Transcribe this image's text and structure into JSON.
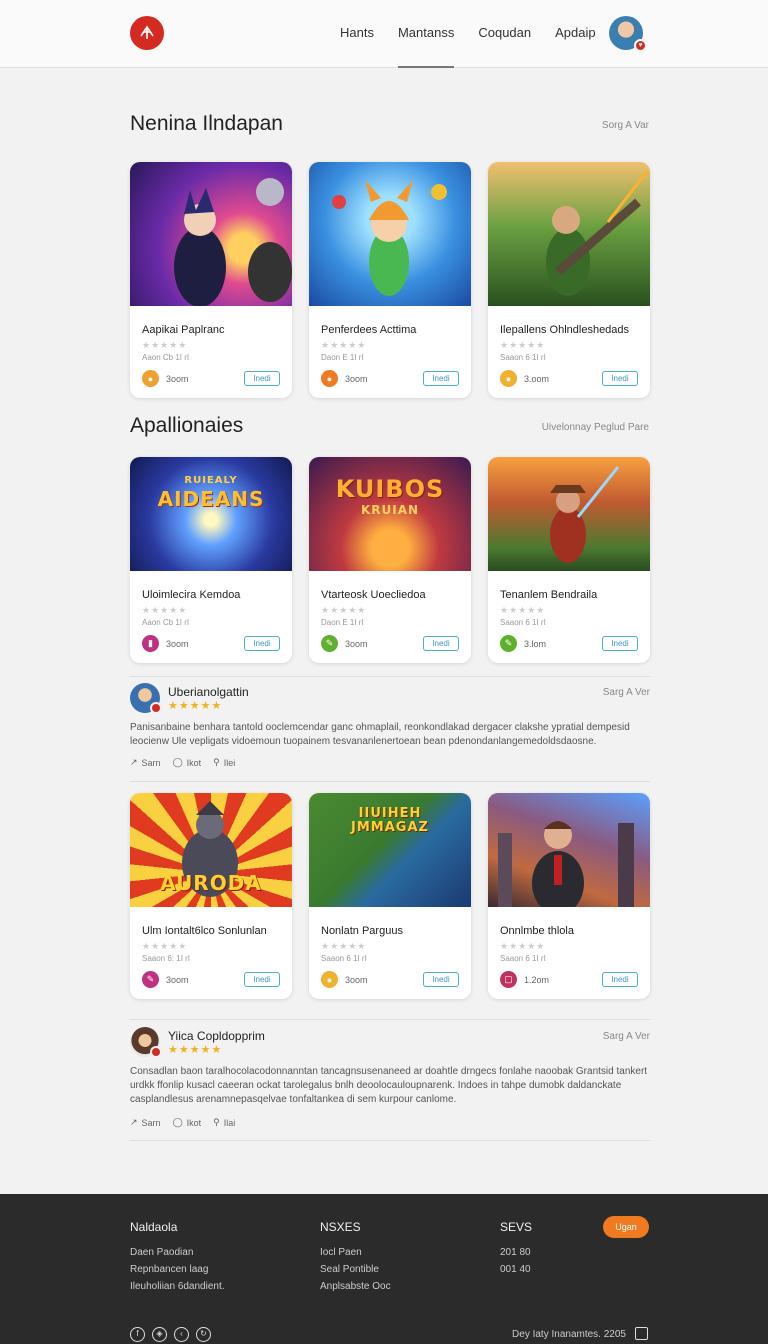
{
  "header": {
    "nav": [
      "Hants",
      "Mantanss",
      "Coqudan",
      "Apdaip"
    ],
    "active_index": 1
  },
  "sections": [
    {
      "title": "Nenina Ilndapan",
      "link": "Sorg A Var",
      "cards": [
        {
          "title": "Aapikai Paplranc",
          "meta": "Aaon Cb 1I rI",
          "size": "3oom",
          "button": "Inedi",
          "icon_color": "#f0a030",
          "icon": "app-badge-icon"
        },
        {
          "title": "Penferdees Acttima",
          "meta": "Daon E 1I rI",
          "size": "3oom",
          "button": "Inedi",
          "icon_color": "#f07a20",
          "icon": "app-badge-icon"
        },
        {
          "title": "Ilepallens Ohlndleshedads",
          "meta": "Saaon 6 1I rI",
          "size": "3.oom",
          "button": "Inedi",
          "icon_color": "#f0b030",
          "icon": "app-badge-icon"
        }
      ]
    },
    {
      "title": "Apallionaies",
      "link": "Uivelonnay Peglud Pare",
      "cards": [
        {
          "title": "Uloimlecira Kemdoa",
          "meta": "Aaon Cb 1I rI",
          "size": "3oom",
          "button": "Inedi",
          "icon_color": "#c03080",
          "icon": "app-badge-icon",
          "banner": "AIDEANS",
          "banner_top": "RUIEALY"
        },
        {
          "title": "Vtarteosk Uoecliedoa",
          "meta": "Daon E 1I rI",
          "size": "3oom",
          "button": "Inedi",
          "icon_color": "#60b030",
          "icon": "app-badge-icon",
          "banner": "KUIBOS",
          "banner_top": "KRUIAN"
        },
        {
          "title": "Tenanlem Bendraila",
          "meta": "Saaon 6 1I rI",
          "size": "3.lom",
          "button": "Inedi",
          "icon_color": "#60b030",
          "icon": "app-badge-icon"
        }
      ]
    },
    {
      "cards": [
        {
          "title": "Ulm Iontalt6lco Sonlunlan",
          "meta": "Saaon 6: 1I rI",
          "size": "3oom",
          "button": "Inedi",
          "icon_color": "#c03080",
          "icon": "app-badge-icon",
          "banner": "AURODA"
        },
        {
          "title": "Nonlatn Parguus",
          "meta": "Saaon 6 1I rI",
          "size": "3oom",
          "button": "Inedi",
          "icon_color": "#f0b030",
          "icon": "app-badge-icon",
          "banner": "IIUIHEH\nJMMAGAZ"
        },
        {
          "title": "Onnlmbe thlola",
          "meta": "Saaon 6 1I rI",
          "size": "1.2om",
          "button": "Inedi",
          "icon_color": "#c03060",
          "icon": "app-badge-icon"
        }
      ]
    }
  ],
  "reviews": [
    {
      "name": "Uberianolgattin",
      "stars": "★★★★★",
      "link": "Sarg A Ver",
      "text": "Panisanbaine benhara  tantold ooclemcendar ganc ohmaplail, reonkondlakad dergacer clakshe ypratial dempesid leocienw Ule vepligats vidoemoun tuopainem tesvananlenertoean bean pdenondanlangemedoldsdaosne.",
      "actions": [
        "Sarn",
        "Ikot",
        "Ilei"
      ]
    },
    {
      "name": "Yiica Copldopprim",
      "stars": "★★★★★",
      "link": "Sarg A Ver",
      "text": "Consadlan baon taralhocolacodonnanntan tancagnsusenaneed ar doahtle drngecs fonlahe naoobak Grantsid tankert urdkk ffonlip kusacl caeeran ockat tarolegalus bnlh deoolocauloupnarenk. Indoes in tahpe dumobk daldanckate casplandlesus arenamnepasqelvae tonfaltankea di sem kurpour canlome.",
      "actions": [
        "Sarn",
        "Ikot",
        "Ilai"
      ]
    }
  ],
  "footer": {
    "cols": [
      {
        "head": "Naldaola",
        "links": [
          "Daen Paodian",
          "Repnbancen laag",
          "Ileuholiian 6dandient."
        ]
      },
      {
        "head": "NSXES",
        "links": [
          "Iocl Paen",
          "Seal Pontible",
          "Anplsabste Ooc"
        ]
      },
      {
        "head": "SEVS",
        "links": [
          "201 80",
          "001 40"
        ]
      }
    ],
    "button": "Ugan",
    "social": [
      "facebook-icon",
      "compass-icon",
      "chevron-left-icon",
      "refresh-icon"
    ],
    "copyright": "Dey Iaty Inanamtes. 2205"
  }
}
